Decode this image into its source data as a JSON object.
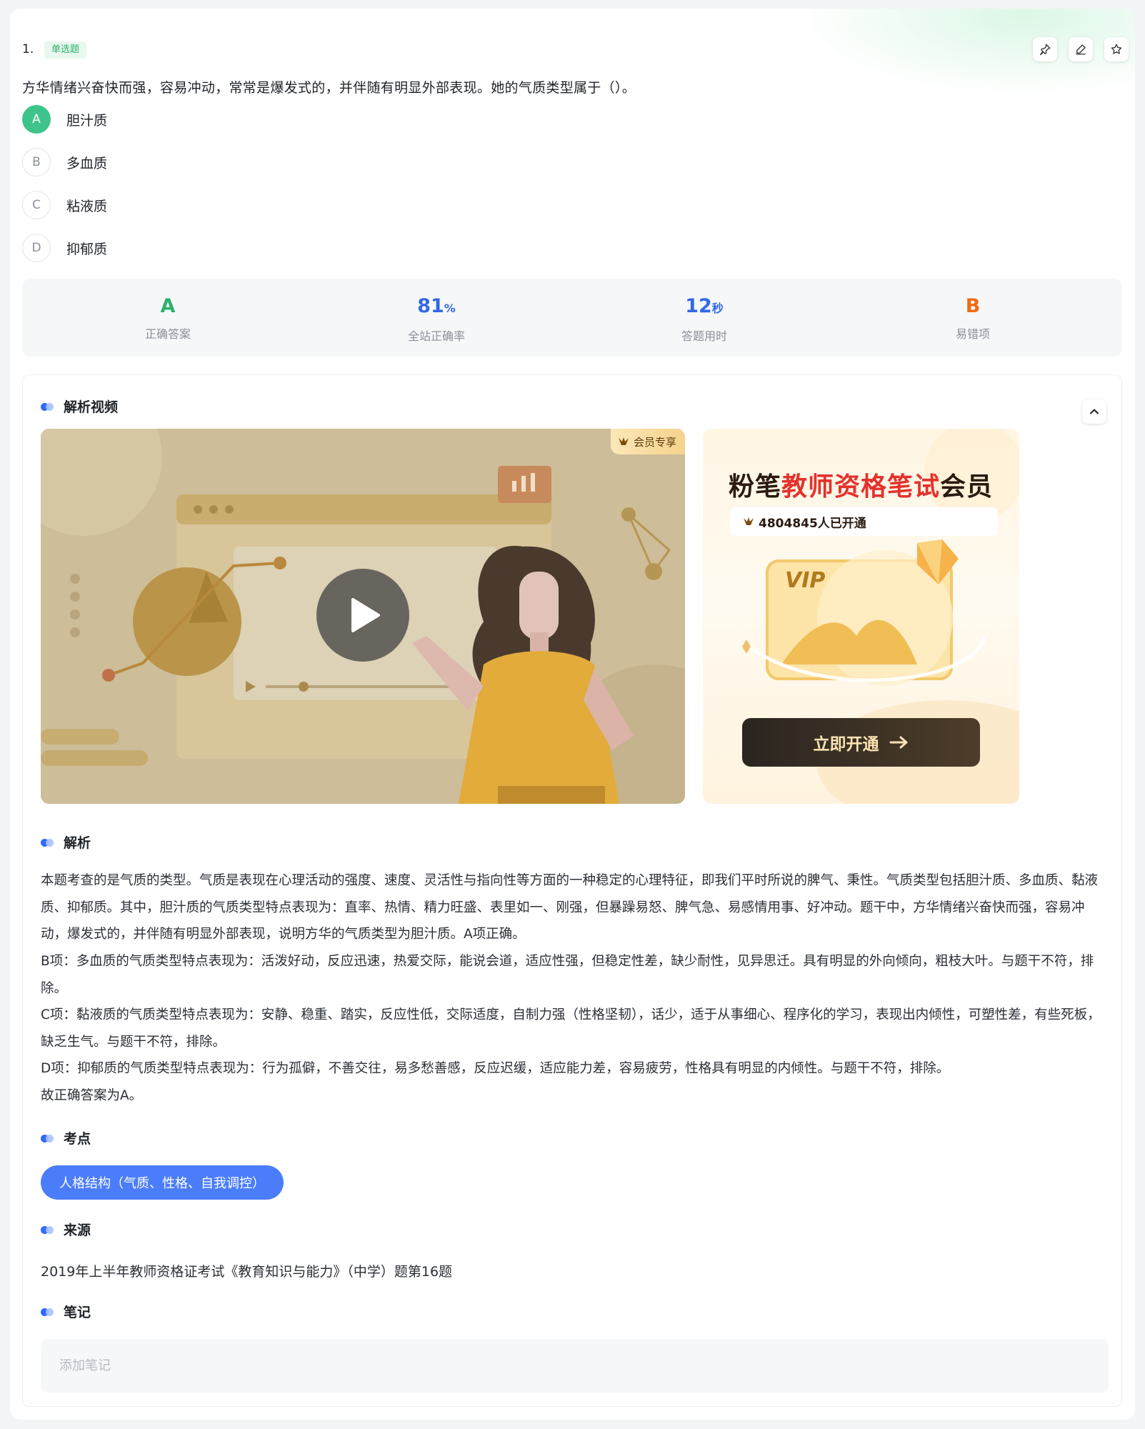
{
  "question": {
    "number": "1.",
    "type_tag": "单选题",
    "stem": "方华情绪兴奋快而强，容易冲动，常常是爆发式的，并伴随有明显外部表现。她的气质类型属于（）。",
    "options": [
      {
        "letter": "A",
        "text": "胆汁质",
        "correct": true
      },
      {
        "letter": "B",
        "text": "多血质",
        "correct": false
      },
      {
        "letter": "C",
        "text": "粘液质",
        "correct": false
      },
      {
        "letter": "D",
        "text": "抑郁质",
        "correct": false
      }
    ]
  },
  "toolbar": {
    "icons": [
      "pin-icon",
      "edit-icon",
      "star-icon"
    ]
  },
  "stats": {
    "correct_answer": {
      "value": "A",
      "label": "正确答案",
      "color": "#2db06b"
    },
    "accuracy": {
      "value": "81",
      "unit": "%",
      "label": "全站正确率",
      "color": "#3168e8"
    },
    "time": {
      "value": "12",
      "unit": "秒",
      "label": "答题用时",
      "color": "#3168e8"
    },
    "common_wrong": {
      "value": "B",
      "label": "易错项",
      "color": "#f26a10"
    }
  },
  "video_section": {
    "title": "解析视频",
    "vip_badge": "会员专享"
  },
  "promo": {
    "title_prefix": "粉笔",
    "title_highlight": "教师资格笔试",
    "title_suffix": "会员",
    "count_text": "4804845人已开通",
    "card_text": "VIP",
    "cta": "立即开通"
  },
  "analysis": {
    "title": "解析",
    "paragraphs": [
      "本题考查的是气质的类型。气质是表现在心理活动的强度、速度、灵活性与指向性等方面的一种稳定的心理特征，即我们平时所说的脾气、秉性。气质类型包括胆汁质、多血质、黏液质、抑郁质。其中，胆汁质的气质类型特点表现为：直率、热情、精力旺盛、表里如一、刚强，但暴躁易怒、脾气急、易感情用事、好冲动。题干中，方华情绪兴奋快而强，容易冲动，爆发式的，并伴随有明显外部表现，说明方华的气质类型为胆汁质。A项正确。",
      "B项：多血质的气质类型特点表现为：活泼好动，反应迅速，热爱交际，能说会道，适应性强，但稳定性差，缺少耐性，见异思迁。具有明显的外向倾向，粗枝大叶。与题干不符，排除。",
      "C项：黏液质的气质类型特点表现为：安静、稳重、踏实，反应性低，交际适度，自制力强（性格坚韧），话少，适于从事细心、程序化的学习，表现出内倾性，可塑性差，有些死板，缺乏生气。与题干不符，排除。",
      "D项：抑郁质的气质类型特点表现为：行为孤僻，不善交往，易多愁善感，反应迟缓，适应能力差，容易疲劳，性格具有明显的内倾性。与题干不符，排除。",
      "故正确答案为A。"
    ]
  },
  "knowledge": {
    "title": "考点",
    "tag": "人格结构（气质、性格、自我调控）"
  },
  "source": {
    "title": "来源",
    "text": "2019年上半年教师资格证考试《教育知识与能力》（中学）题第16题"
  },
  "notes": {
    "title": "笔记",
    "placeholder": "添加笔记",
    "value": ""
  }
}
